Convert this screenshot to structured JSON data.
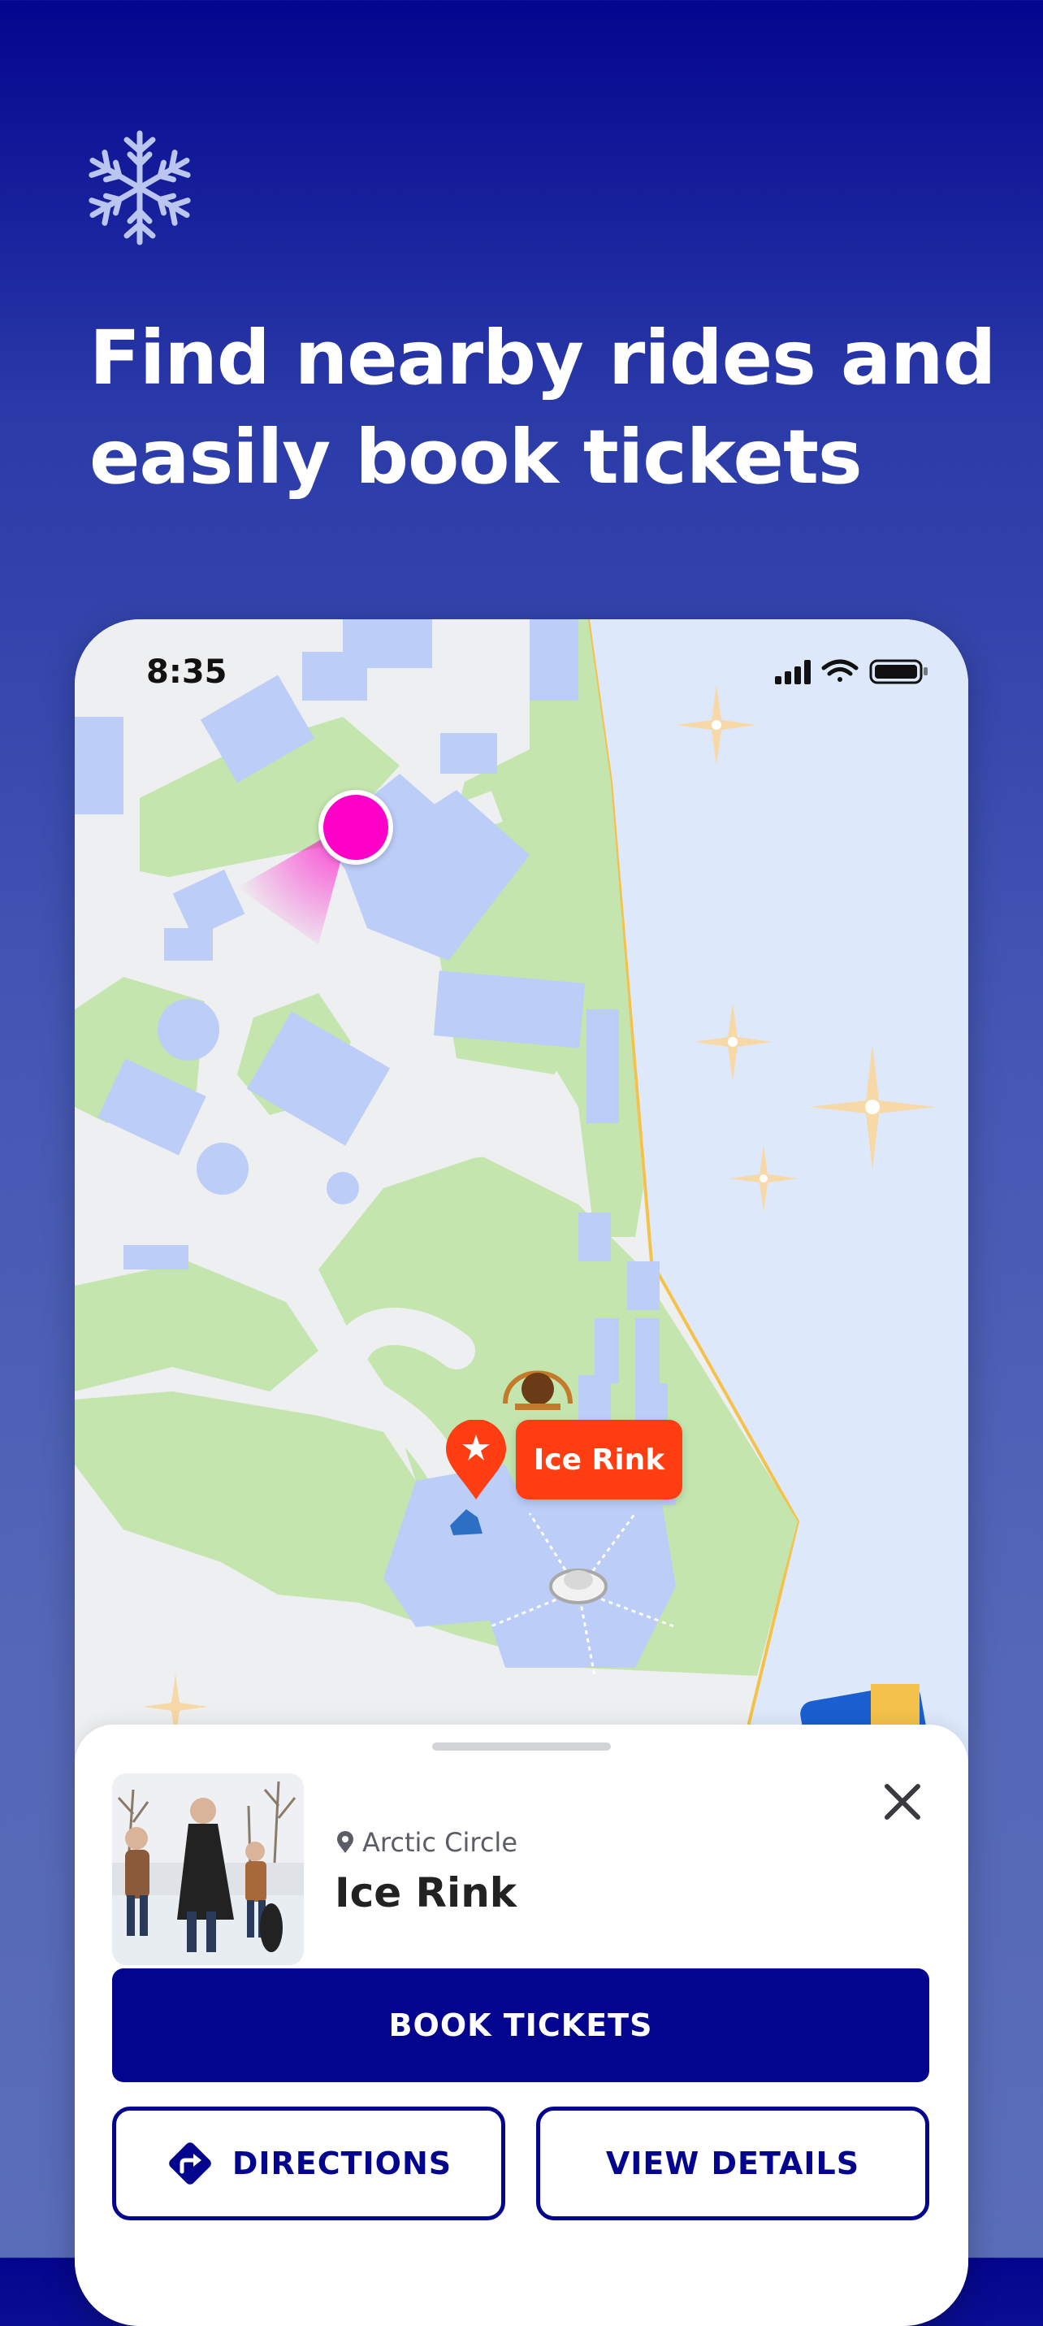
{
  "headline": {
    "line1": "Find nearby rides and",
    "line2": "easily book tickets"
  },
  "status_bar": {
    "time": "8:35"
  },
  "map": {
    "marker_label": "Ice Rink",
    "icons": [
      "user-location-dot",
      "ice-rink-pin-icon",
      "sparkle-icon"
    ]
  },
  "place_card": {
    "location": "Arctic Circle",
    "title": "Ice Rink",
    "book_label": "BOOK TICKETS",
    "directions_label": "DIRECTIONS",
    "details_label": "VIEW DETAILS"
  },
  "colors": {
    "brand_navy": "#03058e",
    "marker_orange": "#ff3d12",
    "user_dot": "#ff00c8",
    "park_green": "#c4e5ae",
    "building_blue": "#bccdf7",
    "water": "#dde9fb"
  }
}
